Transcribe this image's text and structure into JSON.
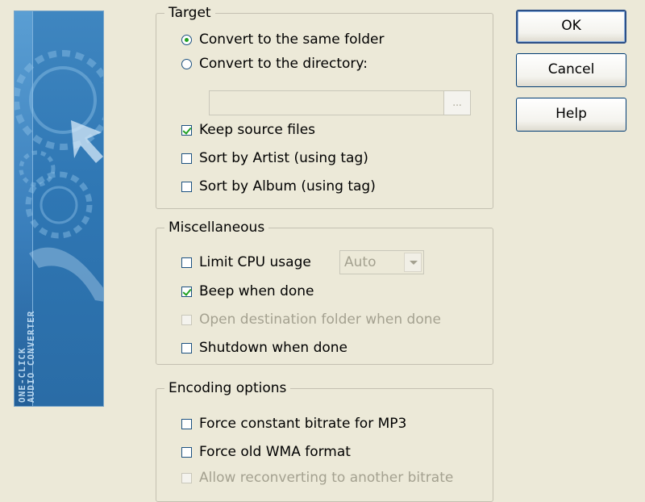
{
  "banner": {
    "line1": "ONE-CLICK",
    "line2": "AUDIO CONVERTER"
  },
  "target": {
    "title": "Target",
    "same_folder": "Convert to the same folder",
    "to_directory": "Convert to the directory:",
    "directory_value": "",
    "browse_label": "...",
    "keep_source": "Keep source files",
    "sort_artist": "Sort by Artist (using tag)",
    "sort_album": "Sort by Album (using tag)"
  },
  "misc": {
    "title": "Miscellaneous",
    "limit_cpu": "Limit CPU usage",
    "cpu_value": "Auto",
    "beep": "Beep when done",
    "open_dest": "Open destination folder when done",
    "shutdown": "Shutdown when done"
  },
  "encoding": {
    "title": "Encoding options",
    "force_cbr": "Force constant bitrate for MP3",
    "force_wma": "Force old WMA format",
    "allow_reconvert": "Allow reconverting to another bitrate"
  },
  "buttons": {
    "ok": "OK",
    "cancel": "Cancel",
    "help": "Help"
  },
  "state": {
    "target_mode": "same_folder",
    "keep_source": true,
    "sort_artist": false,
    "sort_album": false,
    "limit_cpu": false,
    "beep": true,
    "open_dest": false,
    "shutdown": false,
    "force_cbr": false,
    "force_wma": false,
    "allow_reconvert": false
  }
}
